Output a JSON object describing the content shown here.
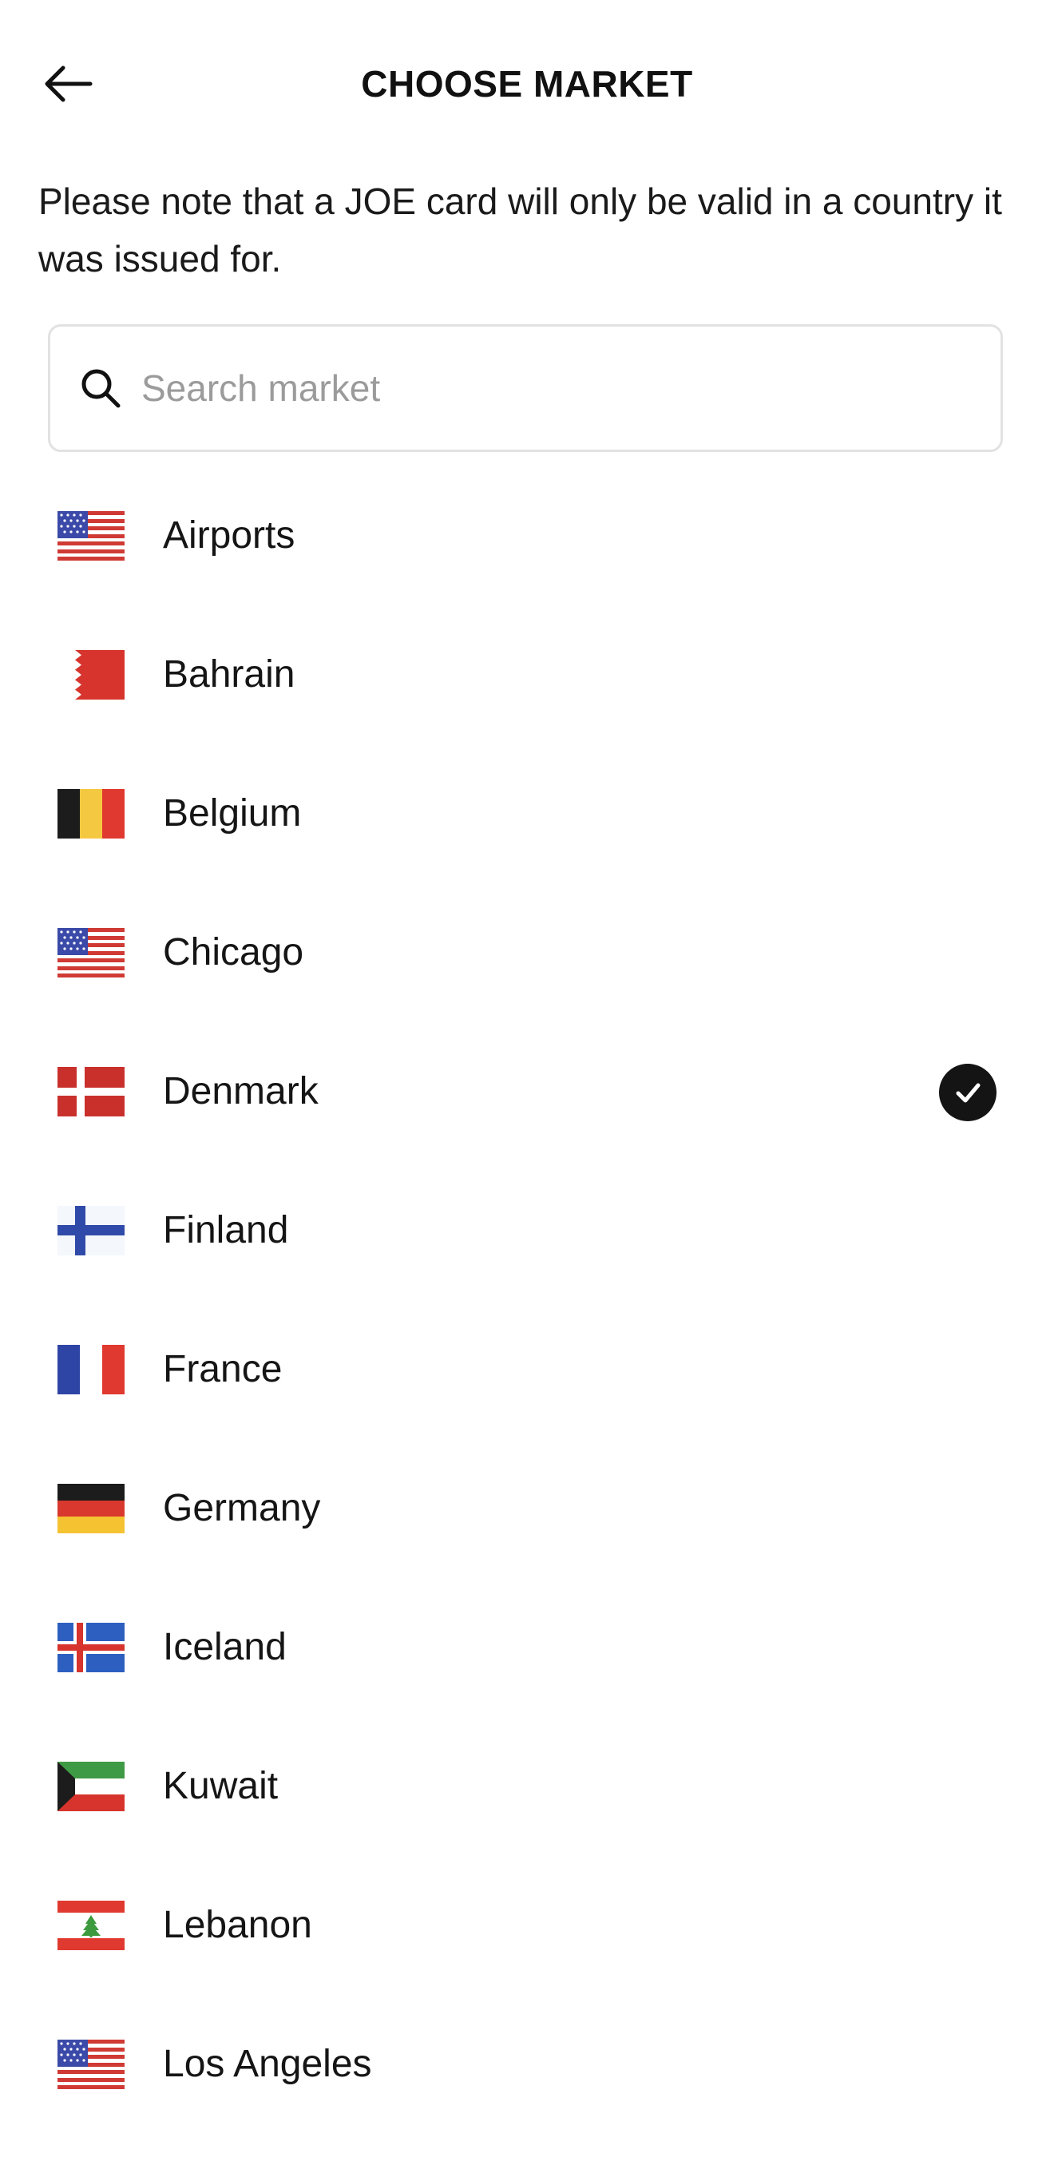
{
  "header": {
    "title": "CHOOSE MARKET",
    "back_icon": "arrow-left-icon"
  },
  "notice": "Please note that a JOE card will only be valid in a country it was issued for.",
  "search": {
    "placeholder": "Search market",
    "value": "",
    "icon": "search-icon"
  },
  "markets": [
    {
      "name": "Airports",
      "flag": "us-flag-icon",
      "selected": false
    },
    {
      "name": "Bahrain",
      "flag": "bahrain-flag-icon",
      "selected": false
    },
    {
      "name": "Belgium",
      "flag": "belgium-flag-icon",
      "selected": false
    },
    {
      "name": "Chicago",
      "flag": "us-flag-icon",
      "selected": false
    },
    {
      "name": "Denmark",
      "flag": "denmark-flag-icon",
      "selected": true
    },
    {
      "name": "Finland",
      "flag": "finland-flag-icon",
      "selected": false
    },
    {
      "name": "France",
      "flag": "france-flag-icon",
      "selected": false
    },
    {
      "name": "Germany",
      "flag": "germany-flag-icon",
      "selected": false
    },
    {
      "name": "Iceland",
      "flag": "iceland-flag-icon",
      "selected": false
    },
    {
      "name": "Kuwait",
      "flag": "kuwait-flag-icon",
      "selected": false
    },
    {
      "name": "Lebanon",
      "flag": "lebanon-flag-icon",
      "selected": false
    },
    {
      "name": "Los Angeles",
      "flag": "us-flag-icon",
      "selected": false
    }
  ],
  "selected_icon": "checkmark-circle-icon",
  "colors": {
    "text": "#151515",
    "placeholder": "#9b9b9b",
    "border": "#e2e2e2",
    "check_bg": "#141414"
  }
}
